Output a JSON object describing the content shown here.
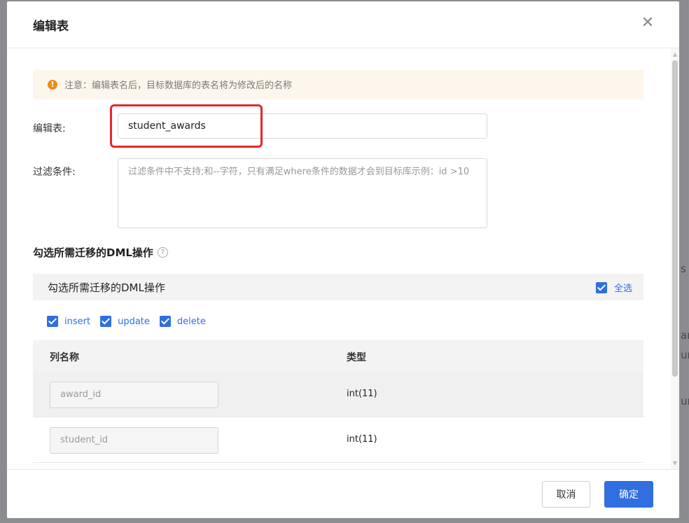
{
  "modal": {
    "title": "编辑表",
    "close_icon": "close-icon"
  },
  "notice": {
    "text": "注意：编辑表名后，目标数据库的表名将为修改后的名称",
    "icon": "warning-icon",
    "icon_glyph": "!"
  },
  "form": {
    "table_label": "编辑表:",
    "table_value": "student_awards",
    "filter_label": "过滤条件:",
    "filter_placeholder": "过滤条件中不支持;和--字符，只有满足where条件的数据才会到目标库示例：id >10"
  },
  "dml": {
    "section_title": "勾选所需迁移的DML操作",
    "help_glyph": "?",
    "panel_title": "勾选所需迁移的DML操作",
    "select_all_label": "全选",
    "select_all_checked": true,
    "operations": [
      {
        "label": "insert",
        "checked": true
      },
      {
        "label": "update",
        "checked": true
      },
      {
        "label": "delete",
        "checked": true
      }
    ]
  },
  "table": {
    "headers": [
      "列名称",
      "类型"
    ],
    "rows": [
      {
        "column": "award_id",
        "type": "int(11)"
      },
      {
        "column": "student_id",
        "type": "int(11)"
      }
    ]
  },
  "footer": {
    "cancel_label": "取消",
    "ok_label": "确定"
  },
  "colors": {
    "accent": "#2f6fe0",
    "highlight": "#e8272a",
    "notice_bg": "#fdf6ec",
    "notice_icon": "#f08c1a"
  }
}
